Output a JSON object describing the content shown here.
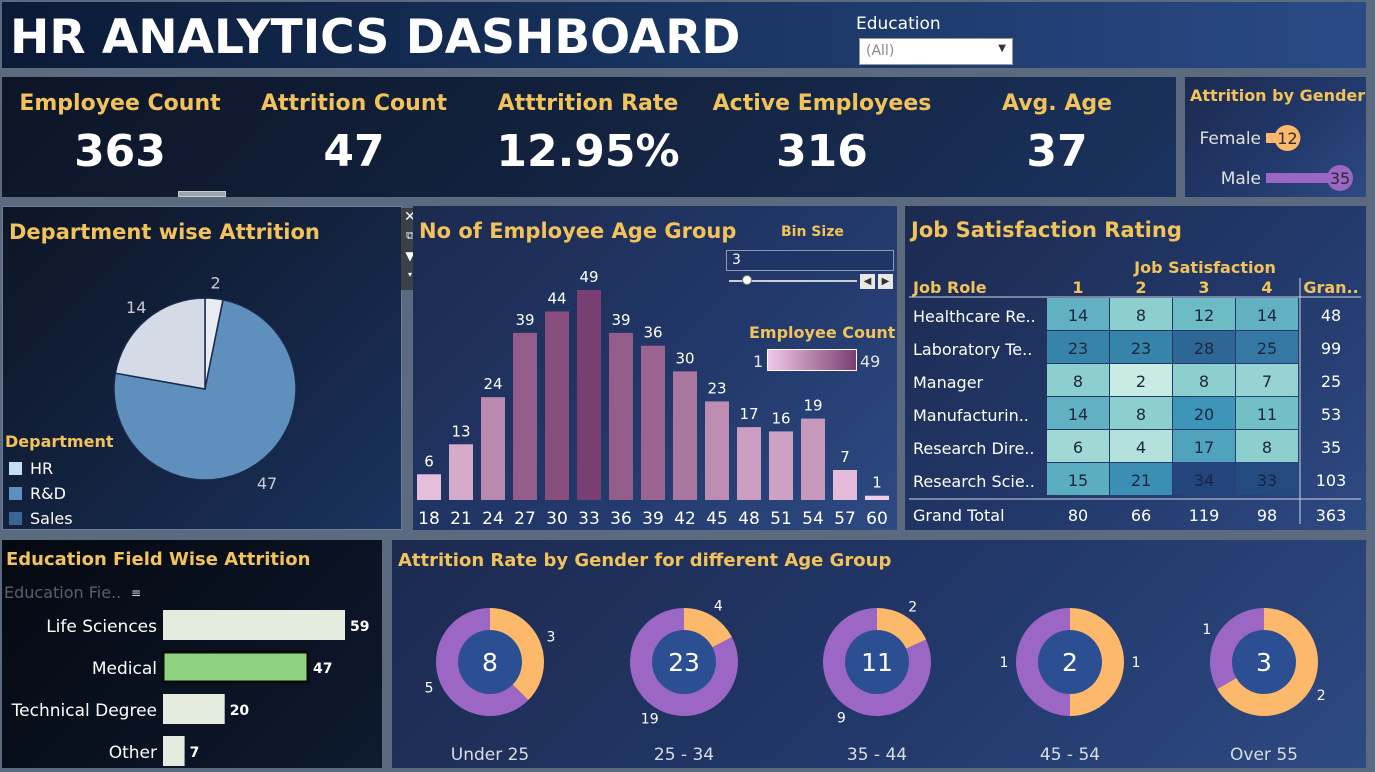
{
  "header": {
    "title": "HR ANALYTICS DASHBOARD",
    "filter_label": "Education",
    "filter_value": "(All)"
  },
  "kpis": [
    {
      "label": "Employee Count",
      "value": "363"
    },
    {
      "label": "Attrition Count",
      "value": "47"
    },
    {
      "label": "Atttrition Rate",
      "value": "12.95%"
    },
    {
      "label": "Active Employees",
      "value": "316"
    },
    {
      "label": "Avg. Age",
      "value": "37"
    }
  ],
  "gender_panel": {
    "title": "Attrition by Gender",
    "rows": [
      {
        "label": "Female",
        "value": 12
      },
      {
        "label": "Male",
        "value": 35
      }
    ]
  },
  "dept_panel": {
    "title": "Department wise Attrition",
    "legend_title": "Department",
    "legend": [
      {
        "label": "HR",
        "color": "#c6dff2"
      },
      {
        "label": "R&D",
        "color": "#5f8fbc"
      },
      {
        "label": "Sales",
        "color": "#3a6492"
      }
    ]
  },
  "age_panel": {
    "title": "No of Employee Age Group",
    "bin_label": "Bin Size",
    "bin_value": "3",
    "legend_title": "Employee Count",
    "legend_min": "1",
    "legend_max": "49"
  },
  "job_panel": {
    "title": "Job Satisfaction Rating",
    "group_header": "Job Satisfaction",
    "row_header": "Job Role",
    "columns": [
      "1",
      "2",
      "3",
      "4"
    ],
    "grand_label": "Gran..",
    "rows": [
      {
        "role": "Healthcare Re..",
        "values": [
          14,
          8,
          12,
          14
        ],
        "total": 48
      },
      {
        "role": "Laboratory Te..",
        "values": [
          23,
          23,
          28,
          25
        ],
        "total": 99
      },
      {
        "role": "Manager",
        "values": [
          8,
          2,
          8,
          7
        ],
        "total": 25
      },
      {
        "role": "Manufacturin..",
        "values": [
          14,
          8,
          20,
          11
        ],
        "total": 53
      },
      {
        "role": "Research Dire..",
        "values": [
          6,
          4,
          17,
          8
        ],
        "total": 35
      },
      {
        "role": "Research Scie..",
        "values": [
          15,
          21,
          34,
          33
        ],
        "total": 103
      }
    ],
    "grand_total_label": "Grand Total",
    "grand_totals": [
      80,
      66,
      119,
      98
    ],
    "grand_total_all": 363
  },
  "edu_panel": {
    "title": "Education Field Wise Attrition",
    "field_header": "Education Fie.."
  },
  "donut_panel": {
    "title": "Attrition Rate by Gender for different Age Group"
  },
  "colors": {
    "gold": "#f1c35a",
    "female": "#fdb96b",
    "male": "#9b66c4",
    "donut_center": "#2c4f93",
    "bar_light": "#e8b7da",
    "bar_dark": "#7a3f72",
    "edu_bar": "#e3ecdf",
    "edu_highlight": "#8ed17e"
  },
  "chart_data": [
    {
      "type": "pie",
      "categories": [
        "HR",
        "R&D",
        "Sales"
      ],
      "values": [
        2,
        47,
        14
      ]
    },
    {
      "type": "bar",
      "categories": [
        "18",
        "21",
        "24",
        "27",
        "30",
        "33",
        "36",
        "39",
        "42",
        "45",
        "48",
        "51",
        "54",
        "57",
        "60"
      ],
      "values": [
        6,
        13,
        24,
        39,
        44,
        49,
        39,
        36,
        30,
        23,
        17,
        16,
        19,
        7,
        1
      ],
      "ylim": [
        0,
        49
      ]
    },
    {
      "type": "bar",
      "categories": [
        "Life Sciences",
        "Medical",
        "Technical Degree",
        "Other"
      ],
      "values": [
        59,
        47,
        20,
        7
      ]
    },
    {
      "type": "bar",
      "categories": [
        "Female",
        "Male"
      ],
      "values": [
        12,
        35
      ]
    },
    {
      "type": "pie",
      "groups": [
        {
          "label": "Under 25",
          "total": 8,
          "female": 3,
          "male": 5
        },
        {
          "label": "25 - 34",
          "total": 23,
          "female": 4,
          "male": 19
        },
        {
          "label": "35 - 44",
          "total": 11,
          "female": 2,
          "male": 9
        },
        {
          "label": "45 - 54",
          "total": 2,
          "female": 1,
          "male": 1
        },
        {
          "label": "Over 55",
          "total": 3,
          "female": 2,
          "male": 1
        }
      ]
    },
    {
      "type": "heatmap",
      "rows": [
        "Healthcare Re..",
        "Laboratory Te..",
        "Manager",
        "Manufacturin..",
        "Research Dire..",
        "Research Scie.."
      ],
      "columns": [
        "1",
        "2",
        "3",
        "4"
      ],
      "values": [
        [
          14,
          8,
          12,
          14
        ],
        [
          23,
          23,
          28,
          25
        ],
        [
          8,
          2,
          8,
          7
        ],
        [
          14,
          8,
          20,
          11
        ],
        [
          6,
          4,
          17,
          8
        ],
        [
          15,
          21,
          34,
          33
        ]
      ]
    }
  ]
}
